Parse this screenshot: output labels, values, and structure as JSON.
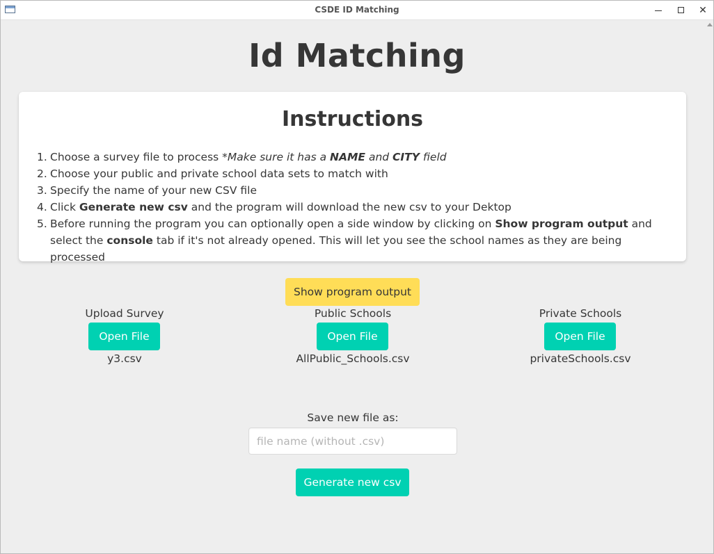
{
  "window": {
    "title": "CSDE ID Matching",
    "controls": [
      "minimize-icon",
      "maximize-icon",
      "close-icon"
    ]
  },
  "page": {
    "heading": "Id Matching"
  },
  "instructions": {
    "title": "Instructions",
    "steps": [
      {
        "num": "1.",
        "parts": [
          {
            "text": "Choose a survey file to process *",
            "style": "normal"
          },
          {
            "text": "Make sure it has a ",
            "style": "italic"
          },
          {
            "text": "NAME",
            "style": "bold-italic"
          },
          {
            "text": " and ",
            "style": "italic"
          },
          {
            "text": "CITY",
            "style": "bold-italic"
          },
          {
            "text": " field",
            "style": "italic"
          }
        ]
      },
      {
        "num": "2.",
        "parts": [
          {
            "text": "Choose your public and private school data sets to match with",
            "style": "normal"
          }
        ]
      },
      {
        "num": "3.",
        "parts": [
          {
            "text": "Specify the name of your new CSV file",
            "style": "normal"
          }
        ]
      },
      {
        "num": "4.",
        "parts": [
          {
            "text": "Click ",
            "style": "normal"
          },
          {
            "text": "Generate new csv",
            "style": "bold"
          },
          {
            "text": " and the program will download the new csv to your Dektop",
            "style": "normal"
          }
        ]
      },
      {
        "num": "5.",
        "parts": [
          {
            "text": "Before running the program you can optionally open a side window by clicking on ",
            "style": "normal"
          },
          {
            "text": "Show program output",
            "style": "bold"
          },
          {
            "text": " and select the ",
            "style": "normal"
          },
          {
            "text": "console",
            "style": "bold"
          },
          {
            "text": " tab if it's not already opened. This will let you see the school names as they are being processed",
            "style": "normal"
          }
        ]
      }
    ]
  },
  "output_button": {
    "label": "Show program output",
    "color": "#ffdd57"
  },
  "uploads": {
    "survey": {
      "label": "Upload Survey",
      "button": "Open File",
      "file": "y3.csv"
    },
    "public": {
      "label": "Public Schools",
      "button": "Open File",
      "file": "AllPublic_Schools.csv"
    },
    "private": {
      "label": "Private Schools",
      "button": "Open File",
      "file": "privateSchools.csv"
    }
  },
  "save": {
    "label": "Save new file as:",
    "placeholder": "file name (without .csv)",
    "value": ""
  },
  "generate_button": {
    "label": "Generate new csv",
    "color": "#00d1b2"
  },
  "colors": {
    "accent": "#00d1b2",
    "warning": "#ffdd57",
    "text": "#363636",
    "background": "#eeeeee"
  }
}
